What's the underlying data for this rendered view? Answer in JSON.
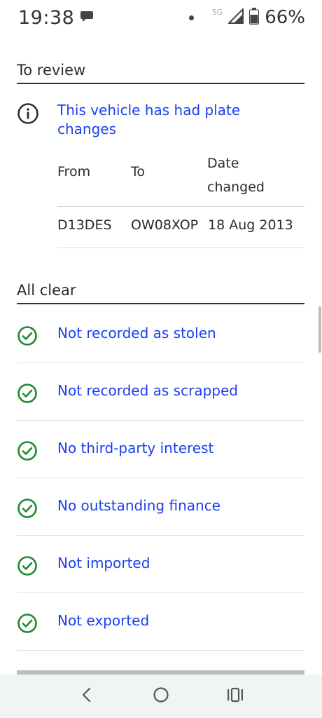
{
  "status_bar": {
    "time": "19:38",
    "network": "5G",
    "battery": "66%"
  },
  "review": {
    "title": "To review",
    "link": "This vehicle has had plate changes",
    "table": {
      "headers": [
        "From",
        "To",
        "Date changed"
      ],
      "rows": [
        [
          "D13DES",
          "OW08XOP",
          "18 Aug 2013"
        ]
      ]
    }
  },
  "all_clear": {
    "title": "All clear",
    "items": [
      "Not recorded as stolen",
      "Not recorded as scrapped",
      "No third-party interest",
      "No outstanding finance",
      "Not imported",
      "Not exported"
    ]
  },
  "colors": {
    "link": "#1a3ff0",
    "check": "#1e8a2e",
    "nav_bg": "#f0f4f2"
  },
  "icons": {
    "info": "info-circle-icon",
    "check": "check-circle-icon",
    "back": "back-chevron-icon",
    "home": "home-circle-icon",
    "recents": "recents-icon"
  }
}
